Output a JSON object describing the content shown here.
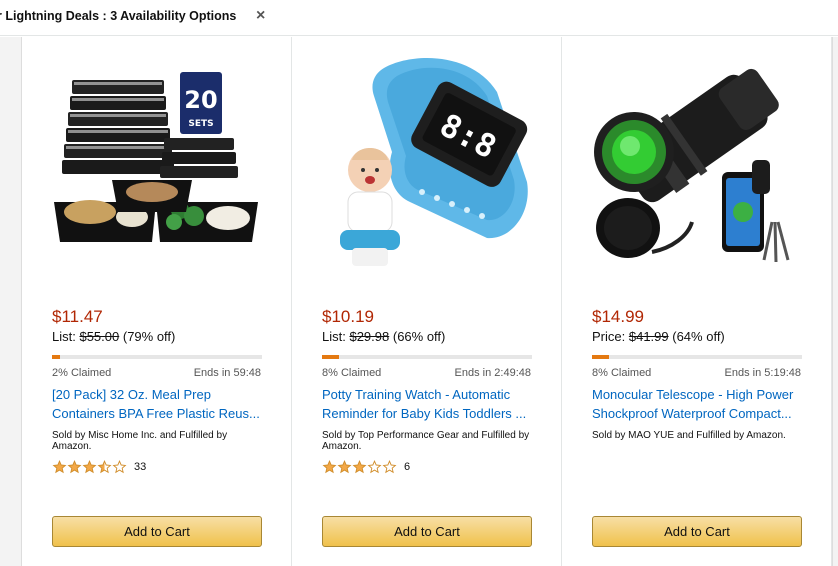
{
  "filter": {
    "text": "r Lightning Deals : 3 Availability Options",
    "close": "×"
  },
  "colors": {
    "price": "#B12704",
    "link": "#0066c0",
    "progress": "#e47911",
    "button": "#f0c14b",
    "star": "#f3a847"
  },
  "deals": [
    {
      "price": "$11.47",
      "list_label": "List:",
      "list_price": "$55.00",
      "discount": "(79% off)",
      "claimed_pct": 2,
      "claimed": "2% Claimed",
      "ends": "Ends in 59:48",
      "title": "[20 Pack] 32 Oz. Meal Prep Containers BPA Free Plastic Reus...",
      "seller": "Sold by Misc Home Inc. and Fulfilled by Amazon.",
      "rating": 3.5,
      "reviews": "33",
      "button": "Add to Cart",
      "badge_number": "20",
      "badge_label": "SETS",
      "image": "meal-prep-containers"
    },
    {
      "price": "$10.19",
      "list_label": "List:",
      "list_price": "$29.98",
      "discount": "(66% off)",
      "claimed_pct": 8,
      "claimed": "8% Claimed",
      "ends": "Ends in 2:49:48",
      "title": "Potty Training Watch - Automatic Reminder for Baby Kids Toddlers ...",
      "seller": "Sold by Top Performance Gear and Fulfilled by Amazon.",
      "rating": 3,
      "reviews": "6",
      "button": "Add to Cart",
      "image": "potty-training-watch"
    },
    {
      "price": "$14.99",
      "list_label": "Price:",
      "list_price": "$41.99",
      "discount": "(64% off)",
      "claimed_pct": 8,
      "claimed": "8% Claimed",
      "ends": "Ends in 5:19:48",
      "title": "Monocular Telescope - High Power Shockproof Waterproof Compact...",
      "seller": "Sold by MAO YUE and Fulfilled by Amazon.",
      "rating": 0,
      "reviews": "",
      "button": "Add to Cart",
      "image": "monocular-telescope"
    }
  ]
}
